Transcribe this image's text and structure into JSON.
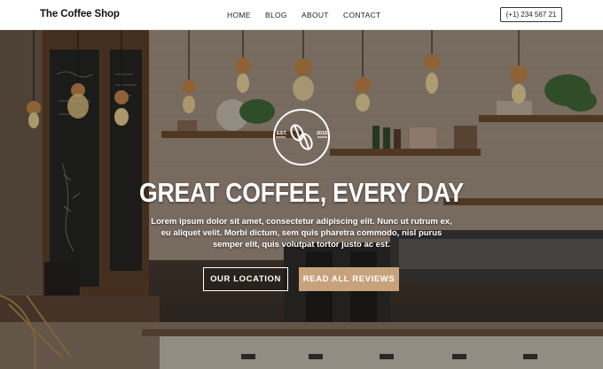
{
  "brand": {
    "name": "The Coffee Shop"
  },
  "nav": {
    "links": [
      "HOME",
      "BLOG",
      "ABOUT",
      "CONTACT"
    ],
    "phone": "(+1) 234 567 21"
  },
  "hero": {
    "logo": {
      "left_text": "EST.",
      "right_text": "2015"
    },
    "headline": "GREAT COFFEE, EVERY DAY",
    "subtext": "Lorem ipsum dolor sit amet, consectetur adipiscing elit. Nunc ut rutrum ex, eu aliquet velit. Morbi dictum, sem quis pharetra commodo, nisl purus semper elit, quis volutpat tortor justo ac est.",
    "buttons": {
      "primary": "OUR LOCATION",
      "secondary": "READ ALL REVIEWS"
    }
  },
  "colors": {
    "accent": "#c8a27c",
    "text_light": "#ffffff",
    "nav_bg": "#ffffff"
  }
}
